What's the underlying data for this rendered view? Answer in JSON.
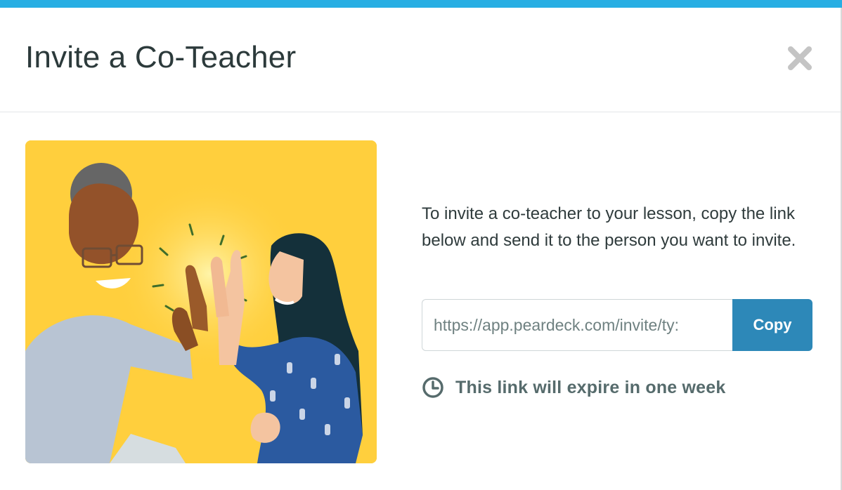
{
  "theme": {
    "accent_color": "#27aee3",
    "button_color": "#2d88b8"
  },
  "modal": {
    "title": "Invite a Co-Teacher",
    "close_icon": "close-icon",
    "illustration_alt": "Two teachers giving a high five"
  },
  "invite": {
    "instructions": "To invite a co-teacher to your lesson, copy the link below and send it to the person you want to invite.",
    "link_value": "https://app.peardeck.com/invite/ty:",
    "copy_label": "Copy",
    "expiry_icon": "clock-icon",
    "expiry_text": "This link will expire in one week"
  }
}
